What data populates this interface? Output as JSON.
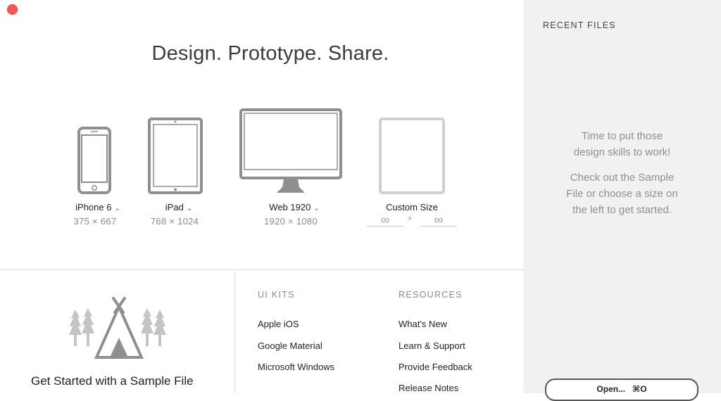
{
  "window": {
    "close_color": "#f25b55"
  },
  "headline": "Design. Prototype. Share.",
  "devices": [
    {
      "name": "iPhone 6",
      "size": "375 × 667",
      "icon": "iphone-icon",
      "dropdown": true
    },
    {
      "name": "iPad",
      "size": "768 × 1024",
      "icon": "ipad-icon",
      "dropdown": true
    },
    {
      "name": "Web 1920",
      "size": "1920 × 1080",
      "icon": "monitor-icon",
      "dropdown": true
    },
    {
      "name": "Custom Size",
      "icon": "custom-frame-icon",
      "dropdown": false
    }
  ],
  "custom_size": {
    "width_value": "∞",
    "height_value": "∞",
    "separator": "×"
  },
  "sample": {
    "label": "Get Started with a Sample File",
    "icon": "teepee-trees-icon"
  },
  "ui_kits": {
    "heading": "UI KITS",
    "items": [
      "Apple iOS",
      "Google Material",
      "Microsoft Windows"
    ]
  },
  "resources": {
    "heading": "RESOURCES",
    "items": [
      "What's New",
      "Learn & Support",
      "Provide Feedback",
      "Release Notes"
    ]
  },
  "sidebar": {
    "title": "RECENT FILES",
    "message_line1": "Time to put those",
    "message_line2": "design skills to work!",
    "message_line3": "Check out the Sample",
    "message_line4": "File or choose a size on",
    "message_line5": "the left to get started.",
    "open_label": "Open...",
    "open_shortcut": "⌘O"
  },
  "colors": {
    "icon_gray": "#8f8f8f",
    "icon_light": "#cfcfcf",
    "sidebar_bg": "#f1f1f1"
  }
}
